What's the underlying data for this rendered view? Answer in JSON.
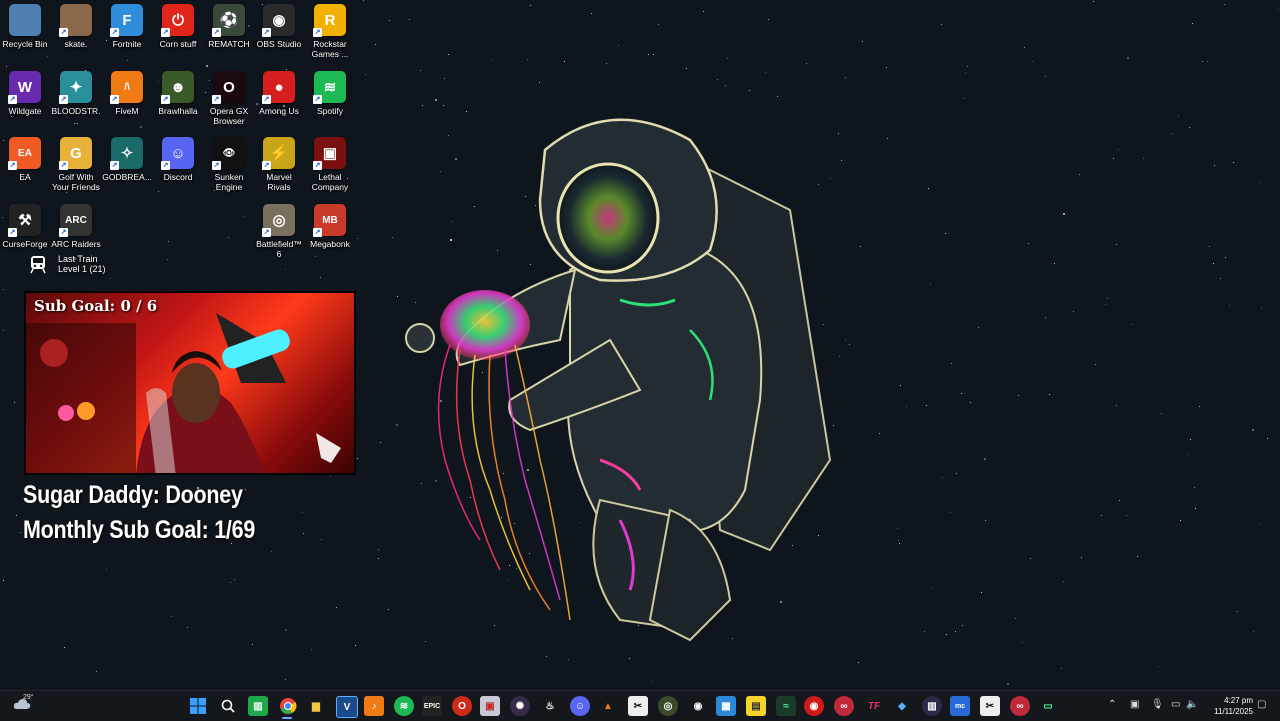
{
  "desktop": {
    "icons": [
      {
        "label": "Recycle Bin",
        "icon": "recycle-bin-icon",
        "color": "#4d7fb3"
      },
      {
        "label": "skate.",
        "icon": "skate-icon",
        "color": "#8a6a4a"
      },
      {
        "label": "Fortnite",
        "icon": "fortnite-icon",
        "color": "#2f8ddb",
        "glyph": "F"
      },
      {
        "label": "Corn stuff",
        "icon": "corn-stuff-icon",
        "color": "#e0261b",
        "glyph": "⏻"
      },
      {
        "label": "REMATCH",
        "icon": "rematch-icon",
        "color": "#3a4a3a",
        "glyph": "⚽"
      },
      {
        "label": "OBS Studio",
        "icon": "obs-studio-icon",
        "color": "#2a2a2a",
        "glyph": "◉"
      },
      {
        "label": "Rockstar Games ...",
        "icon": "rockstar-icon",
        "color": "#f2b100",
        "glyph": "R"
      },
      {
        "label": "Wildgate",
        "icon": "wildgate-icon",
        "color": "#6a2ab0",
        "glyph": "W"
      },
      {
        "label": "BLOODSTR...",
        "icon": "bloodstrike-icon",
        "color": "#2a8f9a",
        "glyph": "✦"
      },
      {
        "label": "FiveM",
        "icon": "fivem-icon",
        "color": "#f07b15",
        "glyph": "/\\"
      },
      {
        "label": "Brawlhalla",
        "icon": "brawlhalla-icon",
        "color": "#3a5a2a",
        "glyph": "☻"
      },
      {
        "label": "Opera GX Browser",
        "icon": "opera-gx-icon",
        "color": "#1a0a0f",
        "glyph": "O"
      },
      {
        "label": "Among Us",
        "icon": "among-us-icon",
        "color": "#d81f1f",
        "glyph": "●"
      },
      {
        "label": "Spotify",
        "icon": "spotify-icon",
        "color": "#1db954",
        "glyph": "≋"
      },
      {
        "label": "EA",
        "icon": "ea-icon",
        "color": "#f05a23",
        "glyph": "EA"
      },
      {
        "label": "Golf With Your Friends",
        "icon": "golf-icon",
        "color": "#e8b23a",
        "glyph": "G"
      },
      {
        "label": "GODBREA...",
        "icon": "godbreakers-icon",
        "color": "#1a6a6a",
        "glyph": "✧"
      },
      {
        "label": "Discord",
        "icon": "discord-icon",
        "color": "#5865f2",
        "glyph": "☺"
      },
      {
        "label": "Sunken Engine",
        "icon": "sunken-engine-icon",
        "color": "#111",
        "glyph": "👁"
      },
      {
        "label": "Marvel Rivals",
        "icon": "marvel-rivals-icon",
        "color": "#c9a51a",
        "glyph": "⚡"
      },
      {
        "label": "Lethal Company",
        "icon": "lethal-company-icon",
        "color": "#7a1010",
        "glyph": "▣"
      },
      {
        "label": "CurseForge",
        "icon": "curseforge-icon",
        "color": "#222",
        "glyph": "⚒"
      },
      {
        "label": "ARC Raiders",
        "icon": "arc-raiders-icon",
        "color": "#333",
        "glyph": "ARC"
      },
      {
        "label": "Battlefield™ 6",
        "icon": "battlefield-icon",
        "color": "#7a7060",
        "glyph": "◎"
      },
      {
        "label": "Megabonk",
        "icon": "megabonk-icon",
        "color": "#c83a2a",
        "glyph": "MB"
      }
    ],
    "train": {
      "line1": "Last Train",
      "line2": "Level 1  (21)"
    }
  },
  "overlay": {
    "sub_goal": "Sub Goal:  0 / 6",
    "sugar_daddy": "Sugar Daddy: Dooney",
    "monthly": "Monthly Sub Goal: 1/69"
  },
  "taskbar": {
    "weather_temp": "29°",
    "time": "4:27 pm",
    "date": "11/11/2025"
  }
}
